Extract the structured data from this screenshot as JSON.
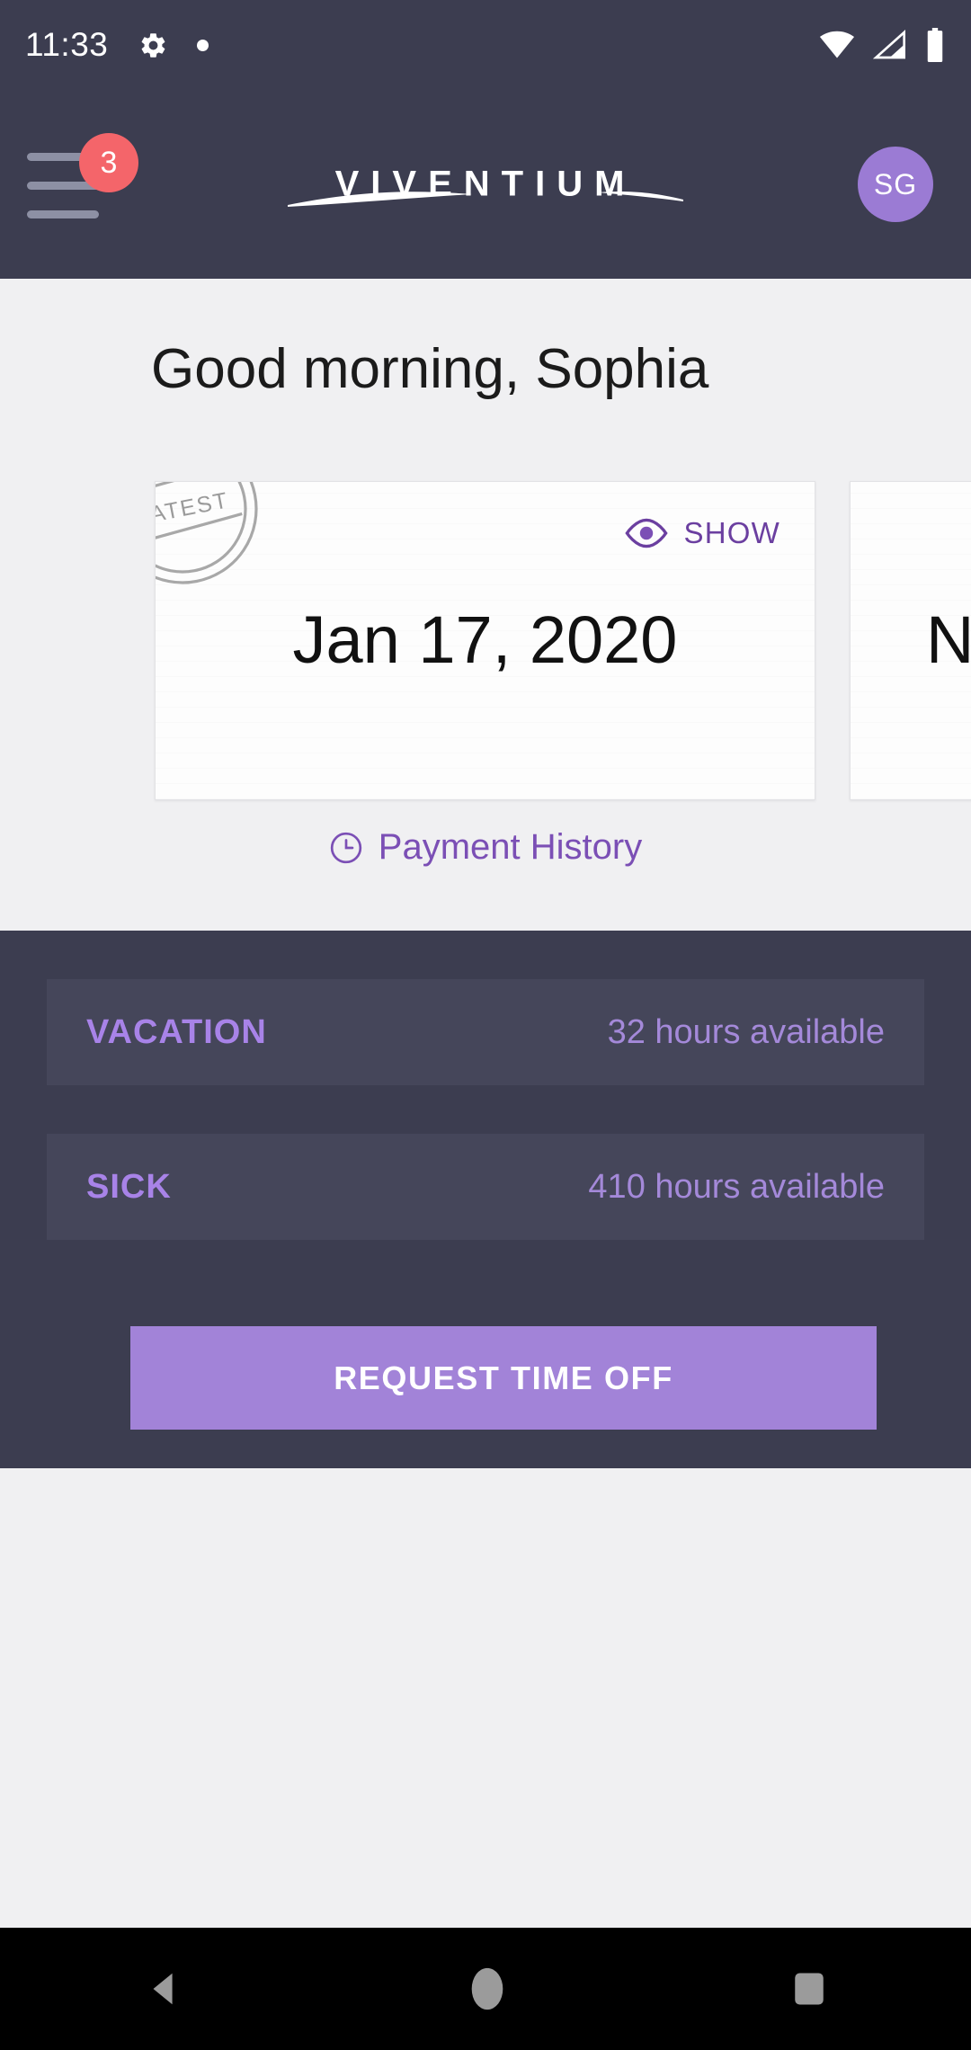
{
  "status_bar": {
    "time": "11:33",
    "icons": [
      "gear-icon",
      "dot-indicator",
      "wifi-icon",
      "cell-signal-icon",
      "battery-icon"
    ]
  },
  "app_bar": {
    "menu_icon": "hamburger-menu-icon",
    "notification_count": "3",
    "logo_text": "VIVENTIUM",
    "avatar_initials": "SG"
  },
  "greeting": "Good morning, Sophia",
  "pay_cards": [
    {
      "stamp": "LATEST",
      "show_label": "SHOW",
      "show_icon": "eye-icon",
      "date": "Jan 17, 2020"
    },
    {
      "date": "N"
    }
  ],
  "payment_history": {
    "icon": "clock-icon",
    "label": "Payment History"
  },
  "time_off": {
    "rows": [
      {
        "type": "VACATION",
        "available": "32 hours available"
      },
      {
        "type": "SICK",
        "available": "410 hours available"
      }
    ],
    "request_button": "REQUEST TIME OFF"
  },
  "nav_bar": {
    "back": "back-triangle-icon",
    "home": "home-circle-icon",
    "recents": "recents-square-icon"
  },
  "colors": {
    "header_dark": "#3C3D50",
    "page_background": "#F0F0F2",
    "accent_purple": "#A283D8",
    "link_purple": "#7B4FB5",
    "badge_red": "#F4656A",
    "row_dark": "#45465A"
  }
}
